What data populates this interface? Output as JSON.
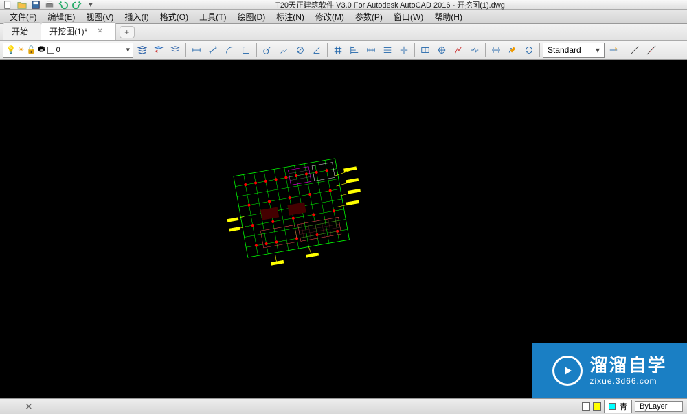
{
  "app": {
    "title": "T20天正建筑软件 V3.0 For Autodesk AutoCAD 2016 - 开挖图(1).dwg"
  },
  "menubar": [
    {
      "label": "文件",
      "key": "F"
    },
    {
      "label": "编辑",
      "key": "E"
    },
    {
      "label": "视图",
      "key": "V"
    },
    {
      "label": "插入",
      "key": "I"
    },
    {
      "label": "格式",
      "key": "O"
    },
    {
      "label": "工具",
      "key": "T"
    },
    {
      "label": "绘图",
      "key": "D"
    },
    {
      "label": "标注",
      "key": "N"
    },
    {
      "label": "修改",
      "key": "M"
    },
    {
      "label": "参数",
      "key": "P"
    },
    {
      "label": "窗口",
      "key": "W"
    },
    {
      "label": "帮助",
      "key": "H"
    }
  ],
  "tabs": {
    "items": [
      {
        "label": "开始",
        "active": false,
        "closable": false
      },
      {
        "label": "开挖图(1)*",
        "active": true,
        "closable": true
      }
    ]
  },
  "layer": {
    "current": "0",
    "icons": [
      "bulb",
      "sun",
      "lock",
      "layer-color"
    ]
  },
  "style": {
    "current": "Standard"
  },
  "status": {
    "color_label": "青",
    "linetype": "ByLayer"
  },
  "watermark": {
    "title": "溜溜自学",
    "url": "zixue.3d66.com"
  }
}
